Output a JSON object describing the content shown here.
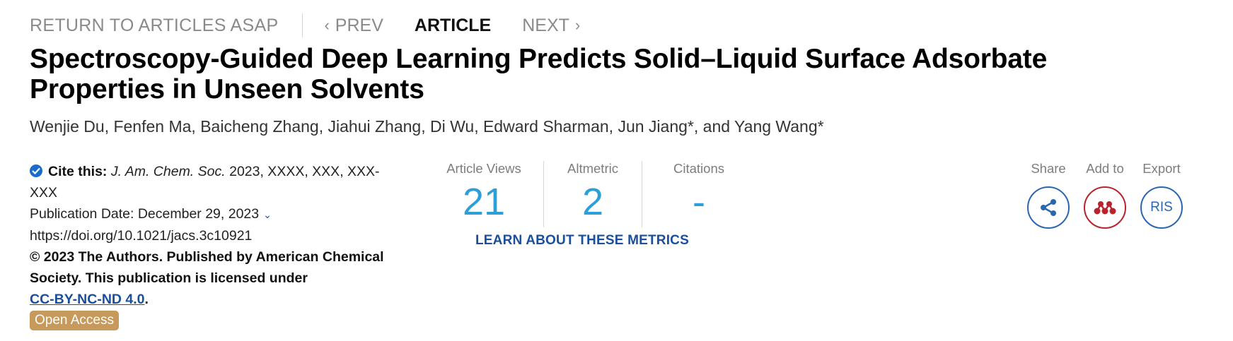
{
  "nav": {
    "return_label": "RETURN TO ARTICLES ASAP",
    "prev_label": "PREV",
    "current_label": "ARTICLE",
    "next_label": "NEXT"
  },
  "article": {
    "title_line1": "Spectroscopy-Guided Deep Learning Predicts Solid–Liquid Surface Adsorbate",
    "title_line2": "Properties in Unseen Solvents",
    "authors": [
      {
        "name": "Wenjie Du",
        "corresponding": ""
      },
      {
        "name": "Fenfen Ma",
        "corresponding": ""
      },
      {
        "name": "Baicheng Zhang",
        "corresponding": ""
      },
      {
        "name": "Jiahui Zhang",
        "corresponding": ""
      },
      {
        "name": "Di Wu",
        "corresponding": ""
      },
      {
        "name": "Edward Sharman",
        "corresponding": ""
      },
      {
        "name": "Jun Jiang",
        "corresponding": "*"
      },
      {
        "name": "Yang Wang",
        "corresponding": "*"
      }
    ],
    "author_separator": ", ",
    "author_last_separator": ", and "
  },
  "cite": {
    "label": "Cite this:",
    "journal": "J. Am. Chem. Soc.",
    "details_line1": "2023, XXXX, XXX, XXX-",
    "details_line2": "XXX",
    "publication_date": "Publication Date: December 29, 2023",
    "doi": "https://doi.org/10.1021/jacs.3c10921",
    "copyright_line1": "© 2023 The Authors. Published by American Chemical",
    "copyright_line2": "Society. This publication is licensed under",
    "license": "CC-BY-NC-ND 4.0",
    "license_suffix": ".",
    "access_badge": "Open Access"
  },
  "metrics": {
    "views_label": "Article Views",
    "views_value": "21",
    "altmetric_label": "Altmetric",
    "altmetric_value": "2",
    "citations_label": "Citations",
    "citations_value": "-",
    "learn_link": "LEARN ABOUT THESE METRICS"
  },
  "actions": {
    "share_label": "Share",
    "add_label": "Add to",
    "export_label": "Export",
    "export_button": "RIS"
  },
  "colors": {
    "metric_value": "#2d9fd8",
    "link": "#1b4f9c",
    "badge": "#c79a5b",
    "mendeley": "#b8232d"
  }
}
